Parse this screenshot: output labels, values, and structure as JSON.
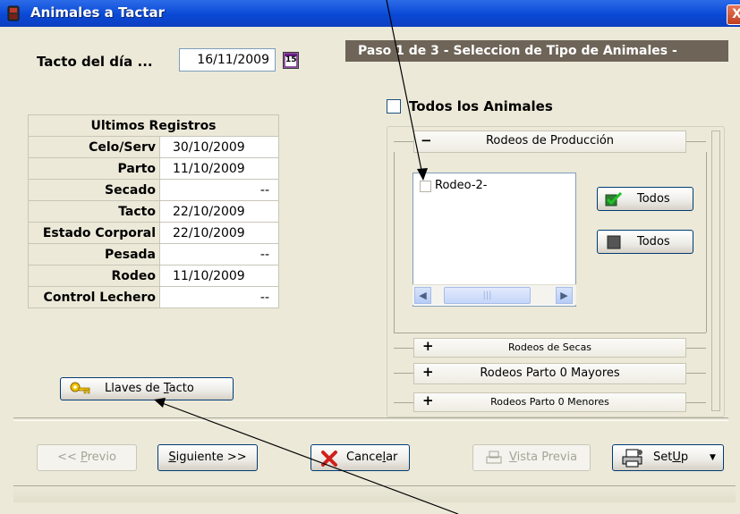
{
  "window": {
    "title": "Animales a Tactar",
    "close_glyph": "X"
  },
  "tacto": {
    "label": "Tacto del día ...",
    "date": "16/11/2009",
    "calendar_icon_text": "15"
  },
  "step_banner": "Paso 1 de 3  - Seleccion de Tipo de Animales -",
  "registros": {
    "header": "Ultimos Registros",
    "rows": [
      {
        "label": "Celo/Serv",
        "value": "30/10/2009"
      },
      {
        "label": "Parto",
        "value": "11/10/2009"
      },
      {
        "label": "Secado",
        "value": "--"
      },
      {
        "label": "Tacto",
        "value": "22/10/2009"
      },
      {
        "label": "Estado Corporal",
        "value": "22/10/2009"
      },
      {
        "label": "Pesada",
        "value": "--"
      },
      {
        "label": "Rodeo",
        "value": "11/10/2009"
      },
      {
        "label": "Control Lechero",
        "value": "--"
      }
    ]
  },
  "llaves_button": {
    "pre": "Llaves de ",
    "key": "T",
    "post": "acto",
    "icon": "key-icon"
  },
  "todos_animales": {
    "label": "Todos los Animales",
    "checked": false
  },
  "rodeos": {
    "produccion": {
      "label": "Rodeos de Producción",
      "symbol": "−"
    },
    "list_items": [
      {
        "label": "Rodeo-2-",
        "checked": false
      }
    ],
    "scroll_thumb_grip": "|||",
    "select_all": "Todos",
    "deselect_all": "Todos",
    "secas": {
      "label": "Rodeos de Secas",
      "symbol": "+"
    },
    "mayores": {
      "label": "Rodeos Parto 0 Mayores",
      "symbol": "+"
    },
    "menores": {
      "label": "Rodeos Parto 0 Menores",
      "symbol": "+"
    }
  },
  "footer": {
    "previo": {
      "pre": "<< ",
      "key": "P",
      "post": "revio",
      "enabled": false
    },
    "siguiente": {
      "pre": "",
      "key": "S",
      "post": "iguiente >>"
    },
    "cancelar": {
      "pre": "Cance",
      "key": "l",
      "post": "ar"
    },
    "vista_previa": {
      "pre": "",
      "key": "V",
      "post": "ista Previa",
      "enabled": false
    },
    "setup": {
      "pre": "Set",
      "key": "U",
      "post": "p"
    }
  },
  "colors": {
    "title_bar": "#0A49D6",
    "banner": "#6E6458",
    "face": "#ECE9D8"
  }
}
